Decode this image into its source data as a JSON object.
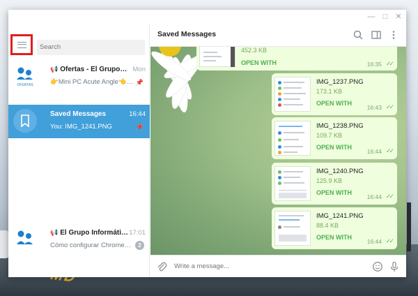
{
  "window": {
    "title": ""
  },
  "sidebar": {
    "search_placeholder": "Search",
    "chats": [
      {
        "name": "Ofertas - El Grupo Informático",
        "time": "Mon",
        "preview": "👉Mini PC Acute Angle👈 ✅",
        "avatar_label": "OFERTAS"
      },
      {
        "name": "Saved Messages",
        "time": "16:44",
        "preview": "You: IMG_1241.PNG"
      },
      {
        "name": "El Grupo Informático",
        "time": "17:01",
        "preview": "Cómo configurar Chromecast",
        "badge": "2"
      }
    ]
  },
  "header": {
    "title": "Saved Messages"
  },
  "messages": [
    {
      "name": "",
      "size": "452.3 KB",
      "action": "OPEN WITH",
      "time": "16:35"
    },
    {
      "name": "IMG_1237.PNG",
      "size": "173.1 KB",
      "action": "OPEN WITH",
      "time": "16:43"
    },
    {
      "name": "IMG_1238.PNG",
      "size": "109.7 KB",
      "action": "OPEN WITH",
      "time": "16:44"
    },
    {
      "name": "IMG_1240.PNG",
      "size": "125.9 KB",
      "action": "OPEN WITH",
      "time": "16:44"
    },
    {
      "name": "IMG_1241.PNG",
      "size": "88.4 KB",
      "action": "OPEN WITH",
      "time": "16:44"
    }
  ],
  "composer": {
    "placeholder": "Write a message..."
  },
  "desktop": {
    "runway_text": "MD"
  },
  "colors": {
    "accent": "#419fd9",
    "bubble": "#efffde",
    "highlight": "#e01e1e",
    "open_with": "#4fae4e"
  },
  "icons": [
    "menu-icon",
    "search-icon",
    "sidebar-toggle-icon",
    "more-icon",
    "attach-icon",
    "emoji-icon",
    "microphone-icon",
    "bookmark-icon",
    "pin-icon",
    "megaphone-icon",
    "double-check-icon"
  ]
}
